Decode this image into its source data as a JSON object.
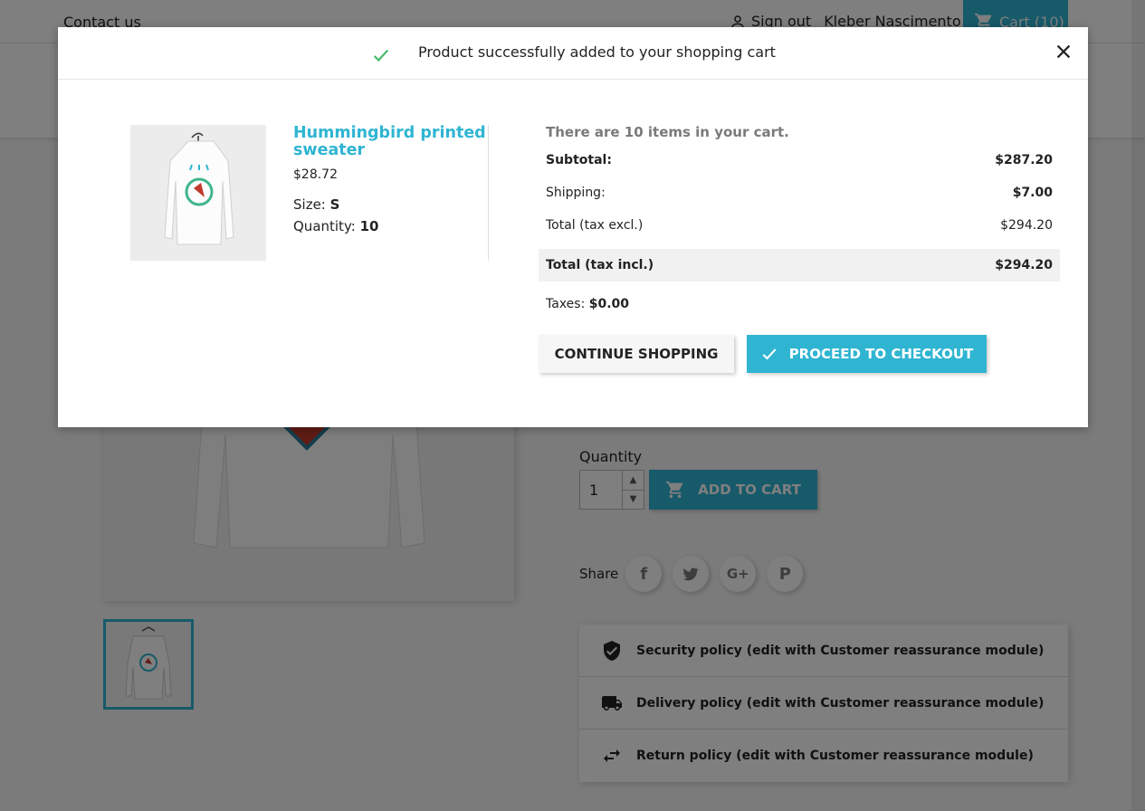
{
  "header": {
    "contact_label": "Contact us",
    "signout_label": "Sign out",
    "user_name": "Kleber Nascimento",
    "cart_label": "Cart (10)"
  },
  "product_page": {
    "quantity_label": "Quantity",
    "quantity_value": "1",
    "add_to_cart_label": "ADD TO CART",
    "share_label": "Share",
    "share_buttons": [
      "facebook-icon",
      "twitter-icon",
      "google-plus-icon",
      "pinterest-icon"
    ],
    "reassurance": [
      {
        "icon": "shield-check-icon",
        "label": "Security policy (edit with Customer reassurance module)"
      },
      {
        "icon": "truck-icon",
        "label": "Delivery policy (edit with Customer reassurance module)"
      },
      {
        "icon": "swap-arrows-icon",
        "label": "Return policy (edit with Customer reassurance module)"
      }
    ]
  },
  "modal": {
    "title": "Product successfully added to your shopping cart",
    "product": {
      "name": "Hummingbird printed sweater",
      "price": "$28.72",
      "size_label": "Size:",
      "size_value": "S",
      "quantity_label": "Quantity:",
      "quantity_value": "10"
    },
    "cart": {
      "count_text": "There are 10 items in your cart.",
      "subtotal_label": "Subtotal:",
      "subtotal_value": "$287.20",
      "shipping_label": "Shipping:",
      "shipping_value": "$7.00",
      "total_excl_label": "Total (tax excl.)",
      "total_excl_value": "$294.20",
      "total_incl_label": "Total (tax incl.)",
      "total_incl_value": "$294.20",
      "taxes_label": "Taxes:",
      "taxes_value": "$0.00"
    },
    "continue_label": "CONTINUE SHOPPING",
    "checkout_label": "PROCEED TO CHECKOUT"
  },
  "colors": {
    "accent": "#2fb5d2",
    "success": "#4cbb6c",
    "overlay": "rgba(0,0,0,0.5)"
  }
}
